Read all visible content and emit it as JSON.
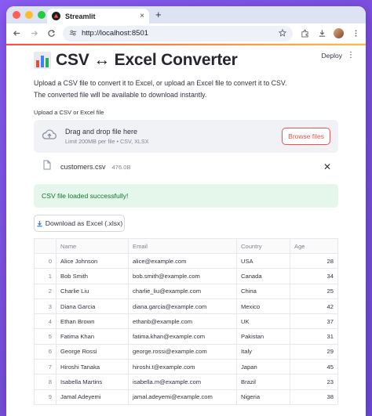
{
  "browser": {
    "tab_title": "Streamlit",
    "new_tab": "+",
    "url": "http://localhost:8501"
  },
  "app": {
    "title": "CSV ↔ Excel Converter",
    "deploy_label": "Deploy",
    "menu_glyph": "⋮",
    "description_line1": "Upload a CSV file to convert it to Excel, or upload an Excel file to convert it to CSV.",
    "description_line2": "The converted file will be available to download instantly.",
    "uploader_label": "Upload a CSV or Excel file",
    "dropzone_main": "Drag and drop file here",
    "dropzone_sub": "Limit 200MB per file • CSV, XLSX",
    "browse_label": "Browse files",
    "file_name": "customers.csv",
    "file_size": "476.0B",
    "success_message": "CSV file loaded successfully!",
    "download_label": "Download as Excel (.xlsx)"
  },
  "table": {
    "columns": [
      "",
      "Name",
      "Email",
      "Country",
      "Age"
    ],
    "rows": [
      [
        "0",
        "Alice Johnson",
        "alice@example.com",
        "USA",
        "28"
      ],
      [
        "1",
        "Bob Smith",
        "bob.smith@example.com",
        "Canada",
        "34"
      ],
      [
        "2",
        "Charlie Liu",
        "charlie_liu@example.com",
        "China",
        "25"
      ],
      [
        "3",
        "Diana Garcia",
        "diana.garcia@example.com",
        "Mexico",
        "42"
      ],
      [
        "4",
        "Ethan Brown",
        "ethanb@example.com",
        "UK",
        "37"
      ],
      [
        "5",
        "Fatima Khan",
        "fatima.khan@example.com",
        "Pakistan",
        "31"
      ],
      [
        "6",
        "George Rossi",
        "george.rossi@example.com",
        "Italy",
        "29"
      ],
      [
        "7",
        "Hiroshi Tanaka",
        "hiroshi.t@example.com",
        "Japan",
        "45"
      ],
      [
        "8",
        "Isabella Martins",
        "isabella.m@example.com",
        "Brazil",
        "23"
      ],
      [
        "9",
        "Jamal Adeyemi",
        "jamal.adeyemi@example.com",
        "Nigeria",
        "38"
      ]
    ]
  },
  "colors": {
    "accent": "#ff4b4b",
    "success_bg": "#e5f6ea",
    "success_text": "#177233",
    "background": "#8a5cf6"
  }
}
